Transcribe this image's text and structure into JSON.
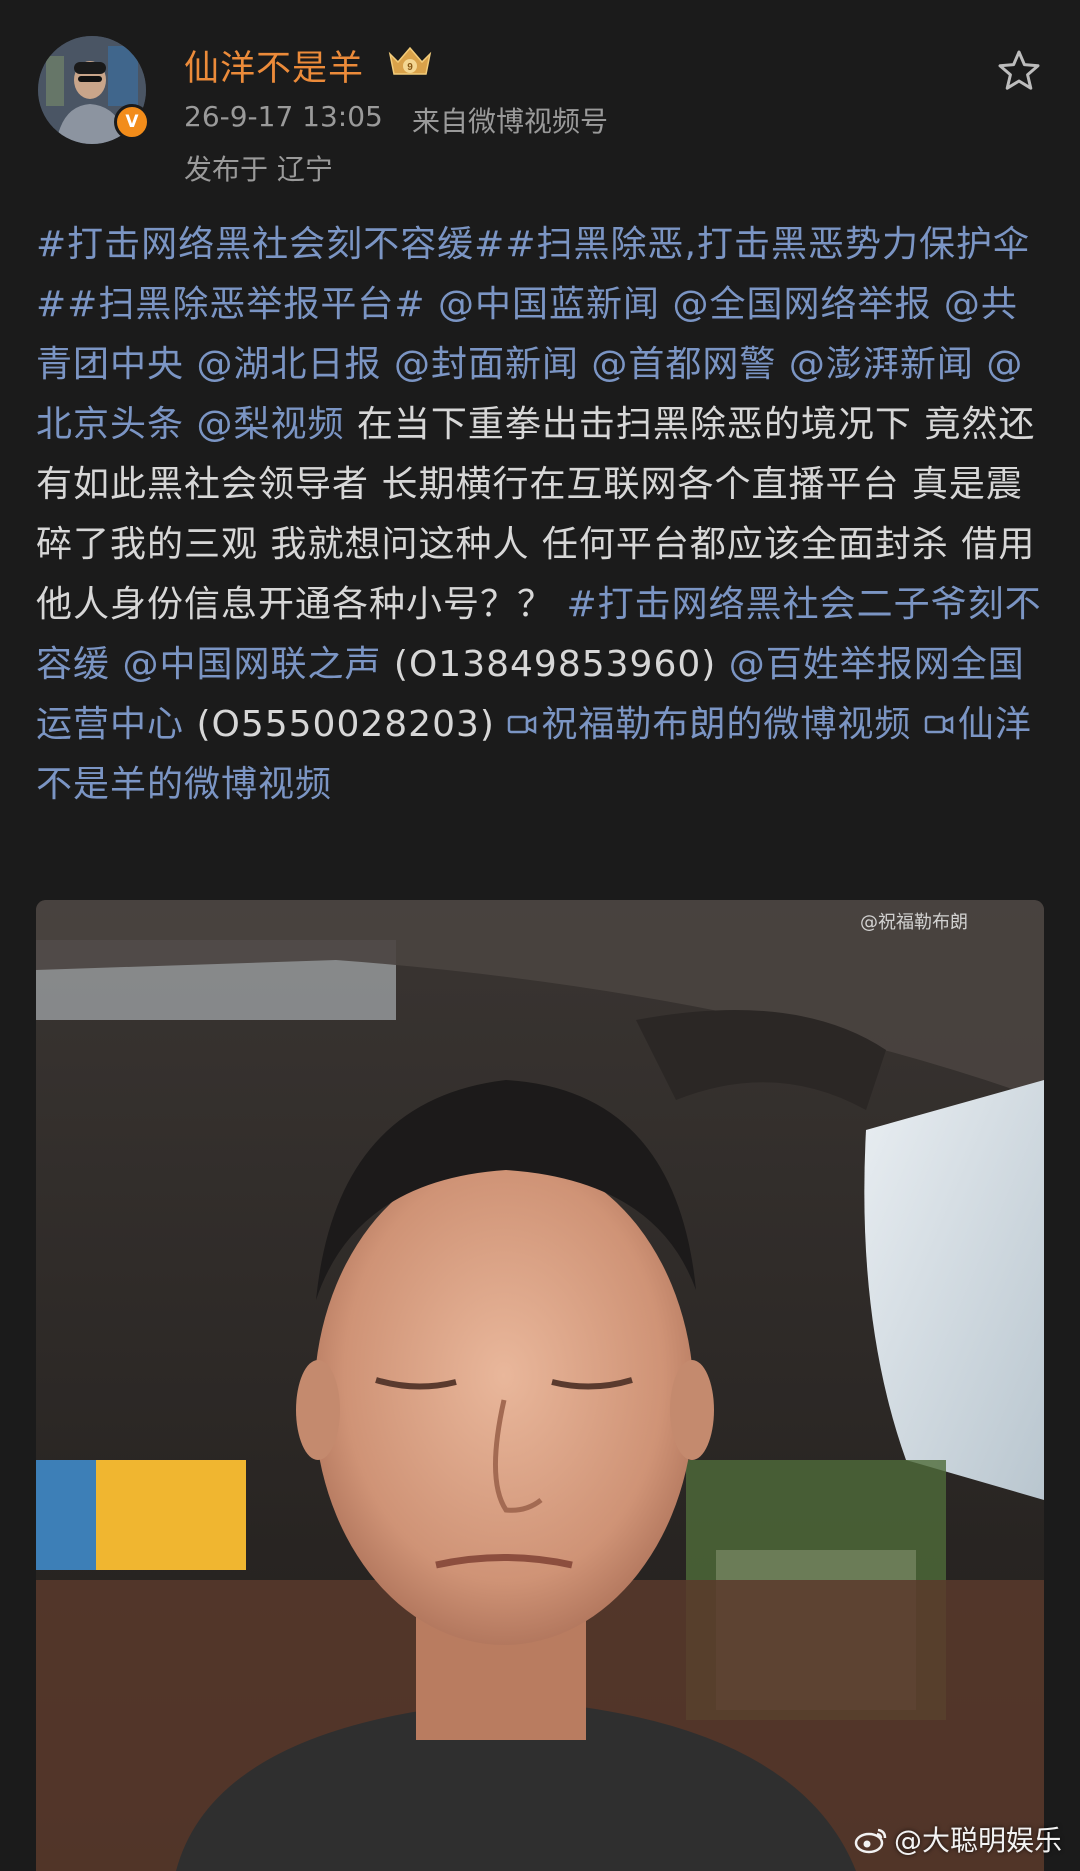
{
  "author": {
    "name": "仙洋不是羊",
    "verified_badge": "V",
    "vip_level": "9"
  },
  "meta": {
    "time": "26-9-17 13:05",
    "source": "来自微博视频号",
    "location": "发布于 辽宁"
  },
  "post": {
    "segments": [
      {
        "type": "link",
        "text": "#打击网络黑社会刻不容缓#"
      },
      {
        "type": "link",
        "text": "#扫黑除恶,打击黑恶势力保护伞#"
      },
      {
        "type": "link",
        "text": "#扫黑除恶举报平台#"
      },
      {
        "type": "plain",
        "text": " "
      },
      {
        "type": "link",
        "text": "@中国蓝新闻"
      },
      {
        "type": "plain",
        "text": " "
      },
      {
        "type": "link",
        "text": "@全国网络举报"
      },
      {
        "type": "plain",
        "text": " "
      },
      {
        "type": "link",
        "text": "@共青团中央"
      },
      {
        "type": "plain",
        "text": " "
      },
      {
        "type": "link",
        "text": "@湖北日报"
      },
      {
        "type": "plain",
        "text": " "
      },
      {
        "type": "link",
        "text": "@封面新闻"
      },
      {
        "type": "plain",
        "text": " "
      },
      {
        "type": "link",
        "text": "@首都网警"
      },
      {
        "type": "plain",
        "text": " "
      },
      {
        "type": "link",
        "text": "@澎湃新闻"
      },
      {
        "type": "plain",
        "text": " "
      },
      {
        "type": "link",
        "text": "@北京头条"
      },
      {
        "type": "plain",
        "text": " "
      },
      {
        "type": "link",
        "text": "@梨视频"
      },
      {
        "type": "plain",
        "text": "  在当下重拳出击扫黑除恶的境况下    竟然还有如此黑社会领导者  长期横行在互联网各个直播平台    真是震碎了我的三观    我就想问这种人 任何平台都应该全面封杀 借用他人身份信息开通各种小号？？ "
      },
      {
        "type": "link",
        "text": "#打击网络黑社会二子爷刻不容缓"
      },
      {
        "type": "plain",
        "text": " "
      },
      {
        "type": "link",
        "text": "@中国网联之声"
      },
      {
        "type": "plain",
        "text": " (O13849853960) "
      },
      {
        "type": "link",
        "text": "@百姓举报网全国运营中心"
      },
      {
        "type": "plain",
        "text": " (O5550028203) "
      },
      {
        "type": "video",
        "text": "祝福勒布朗的微博视频"
      },
      {
        "type": "plain",
        "text": " "
      },
      {
        "type": "video",
        "text": "仙洋不是羊的微博视频"
      }
    ]
  },
  "video": {
    "watermark": "@祝福勒布朗"
  },
  "footer": {
    "watermark": "@大聪明娱乐"
  },
  "icons": {
    "star": "star-icon",
    "video": "video-icon",
    "vip": "vip-crown-icon",
    "weibo": "weibo-icon"
  },
  "colors": {
    "background": "#1b1b1b",
    "username": "#ec8b3a",
    "link": "#7b95c4",
    "text": "#d7d7d7",
    "meta": "#9a9a9a",
    "badge": "#f28c1a"
  }
}
